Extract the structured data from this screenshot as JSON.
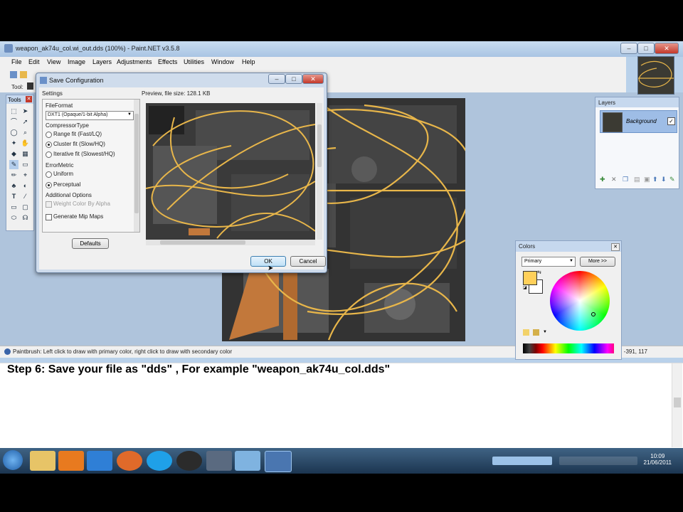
{
  "window": {
    "title": "weapon_ak74u_col.wi_out.dds (100%) - Paint.NET v3.5.8"
  },
  "menu": [
    "File",
    "Edit",
    "View",
    "Image",
    "Layers",
    "Adjustments",
    "Effects",
    "Utilities",
    "Window",
    "Help"
  ],
  "toolbar": {
    "tool_label": "Tool:"
  },
  "tools_panel": {
    "title": "Tools"
  },
  "layers_panel": {
    "title": "Layers",
    "layers": [
      {
        "name": "Background",
        "checked": true
      }
    ]
  },
  "colors_panel": {
    "title": "Colors",
    "mode": "Primary",
    "more_button": "More >>",
    "primary_color": "#ffd05a",
    "secondary_color": "#ffffff"
  },
  "dialog": {
    "title": "Save Configuration",
    "settings_label": "Settings",
    "preview_label": "Preview, file size: 128.1 KB",
    "file_format_label": "FileFormat",
    "file_format_value": "DXT1 (Opaque/1-bit Alpha)",
    "compressor_label": "CompressorType",
    "compressor_options": [
      {
        "label": "Range fit (Fast/LQ)",
        "selected": false
      },
      {
        "label": "Cluster fit (Slow/HQ)",
        "selected": true
      },
      {
        "label": "Iterative fit (Slowest/HQ)",
        "selected": false
      }
    ],
    "error_metric_label": "ErrorMetric",
    "error_metric_options": [
      {
        "label": "Uniform",
        "selected": false
      },
      {
        "label": "Perceptual",
        "selected": true
      }
    ],
    "additional_label": "Additional Options",
    "weight_alpha_label": "Weight Color By Alpha",
    "mipmaps_label": "Generate Mip Maps",
    "defaults_button": "Defaults",
    "ok_button": "OK",
    "cancel_button": "Cancel"
  },
  "statusbar": {
    "text": "Paintbrush: Left click to draw with primary color, right click to draw with secondary color",
    "coords": "-391, 117"
  },
  "caption": "Step 6: Save your file as  \"dds\" , For example \"weapon_ak74u_col.dds\"",
  "taskbar": {
    "time": "10:09",
    "date": "21/06/2011"
  }
}
